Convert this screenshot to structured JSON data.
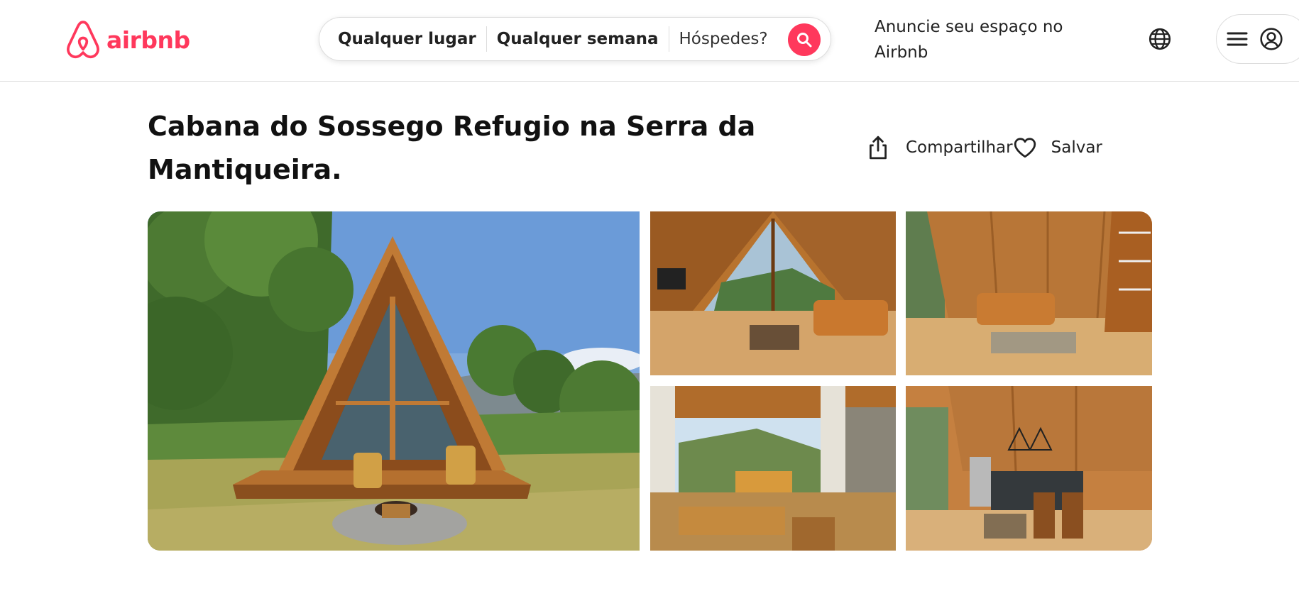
{
  "header": {
    "logo_text": "airbnb",
    "search": {
      "location": "Qualquer lugar",
      "week": "Qualquer semana",
      "guests": "Hóspedes?"
    },
    "host_link": "Anuncie seu espaço no Airbnb"
  },
  "listing": {
    "title": "Cabana do Sossego Refugio na Serra da Mantiqueira.",
    "share_label": "Compartilhar",
    "save_label": "Salvar"
  },
  "colors": {
    "brand": "#ff385c",
    "text": "#222222",
    "border": "#dddddd"
  },
  "icons": [
    "airbnb-logo-icon",
    "search-icon",
    "globe-icon",
    "menu-icon",
    "user-icon",
    "share-icon",
    "heart-icon"
  ]
}
